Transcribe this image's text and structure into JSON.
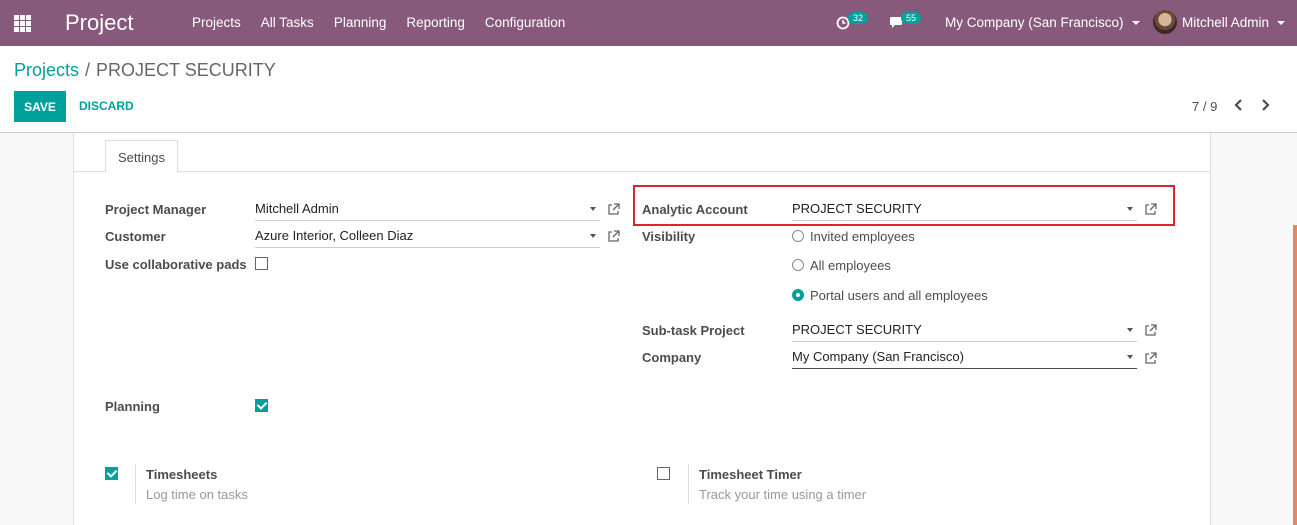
{
  "nav": {
    "app_title": "Project",
    "menu": [
      "Projects",
      "All Tasks",
      "Planning",
      "Reporting",
      "Configuration"
    ],
    "activity_count": "32",
    "message_count": "55",
    "company": "My Company (San Francisco)",
    "user": "Mitchell Admin"
  },
  "control_panel": {
    "breadcrumb_parent": "Projects",
    "breadcrumb_sep": "/",
    "breadcrumb_current": "PROJECT SECURITY",
    "save_label": "SAVE",
    "discard_label": "DISCARD",
    "pager": "7 / 9"
  },
  "form": {
    "tab_label": "Settings",
    "project_manager_label": "Project Manager",
    "project_manager_value": "Mitchell Admin",
    "customer_label": "Customer",
    "customer_value": "Azure Interior, Colleen Diaz",
    "collab_pads_label": "Use collaborative pads",
    "collab_pads_checked": false,
    "analytic_account_label": "Analytic Account",
    "analytic_account_value": "PROJECT SECURITY",
    "visibility_label": "Visibility",
    "visibility_options": [
      "Invited employees",
      "All employees",
      "Portal users and all employees"
    ],
    "visibility_selected": "Portal users and all employees",
    "subtask_project_label": "Sub-task Project",
    "subtask_project_value": "PROJECT SECURITY",
    "company_label": "Company",
    "company_value": "My Company (San Francisco)",
    "planning_label": "Planning",
    "planning_checked": true,
    "timesheets_label": "Timesheets",
    "timesheets_help": "Log time on tasks",
    "timesheets_checked": true,
    "timesheet_timer_label": "Timesheet Timer",
    "timesheet_timer_help": "Track your time using a timer",
    "timesheet_timer_checked": false
  },
  "colors": {
    "brand": "#875a7b",
    "accent": "#00a09d",
    "highlight": "#d9262c"
  }
}
